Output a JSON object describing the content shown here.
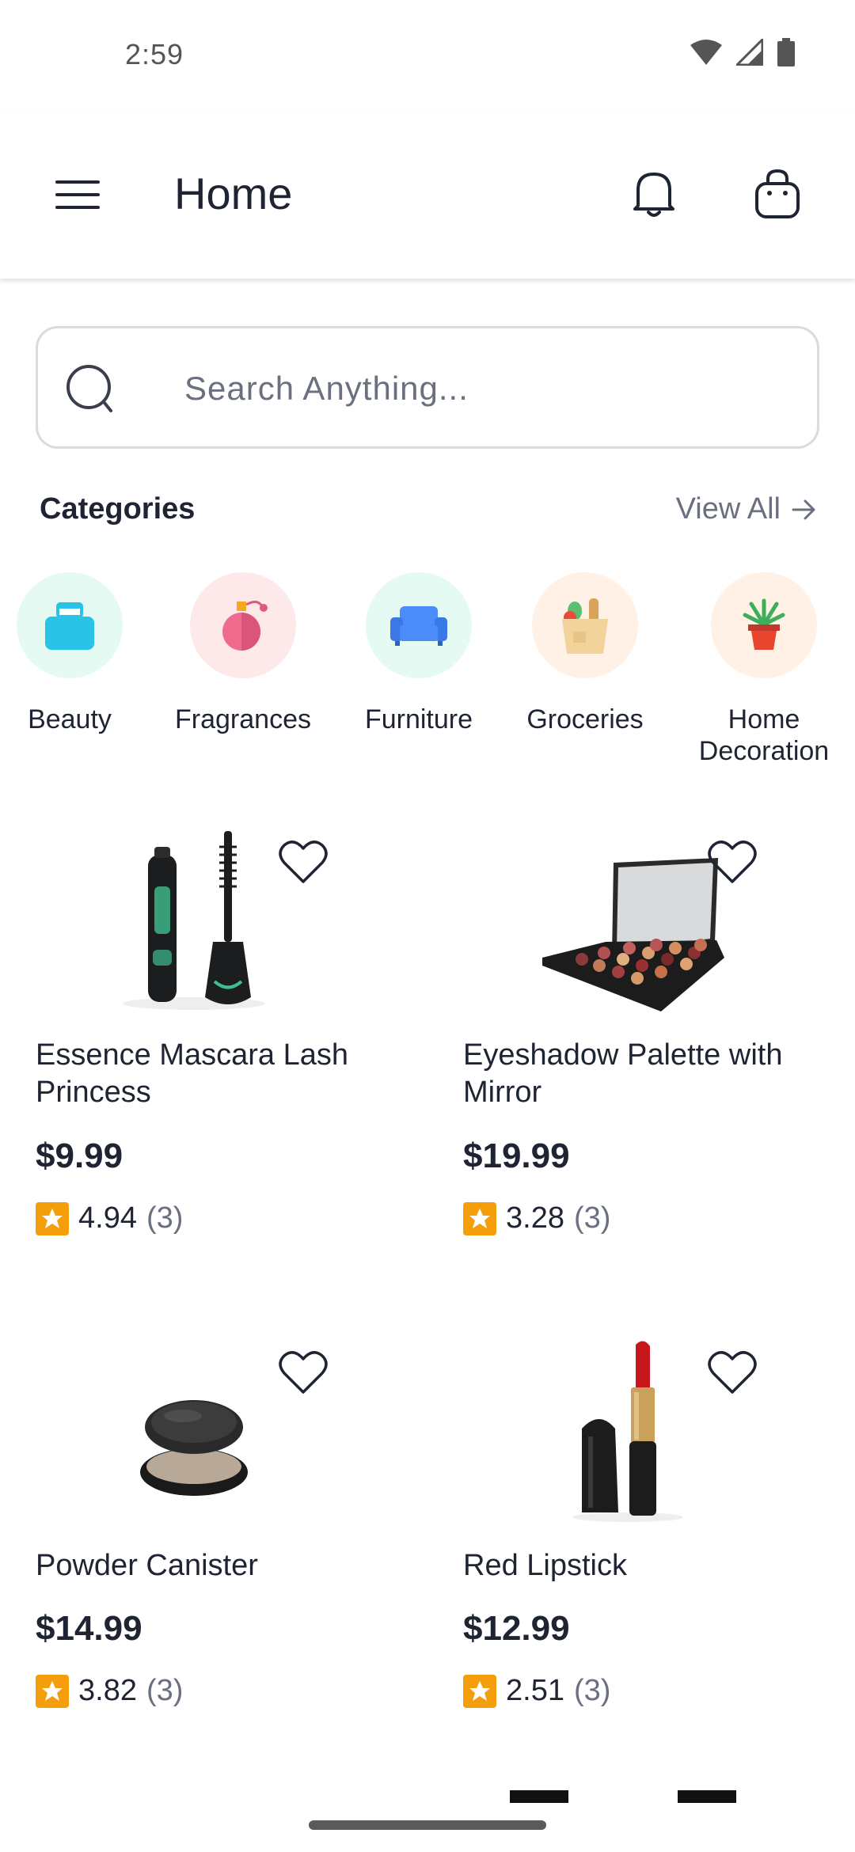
{
  "status": {
    "time": "2:59"
  },
  "header": {
    "title": "Home"
  },
  "search": {
    "placeholder": "Search Anything..."
  },
  "categories": {
    "title": "Categories",
    "view_all": "View All",
    "items": [
      {
        "label": "Beauty",
        "icon": "beauty-icon",
        "bg": "#e6faf4"
      },
      {
        "label": "Fragrances",
        "icon": "perfume-icon",
        "bg": "#fde8ea"
      },
      {
        "label": "Furniture",
        "icon": "sofa-icon",
        "bg": "#e6faf4"
      },
      {
        "label": "Groceries",
        "icon": "grocery-bag-icon",
        "bg": "#fff1e6"
      },
      {
        "label": "Home Decoration",
        "icon": "plant-pot-icon",
        "bg": "#fff1e6"
      }
    ]
  },
  "products": [
    {
      "name": "Essence Mascara Lash Princess",
      "price": "$9.99",
      "rating": "4.94",
      "reviews": "(3)",
      "icon": "mascara-image"
    },
    {
      "name": "Eyeshadow Palette with Mirror",
      "price": "$19.99",
      "rating": "3.28",
      "reviews": "(3)",
      "icon": "eyeshadow-palette-image"
    },
    {
      "name": "Powder Canister",
      "price": "$14.99",
      "rating": "3.82",
      "reviews": "(3)",
      "icon": "powder-canister-image"
    },
    {
      "name": "Red Lipstick",
      "price": "$12.99",
      "rating": "2.51",
      "reviews": "(3)",
      "icon": "lipstick-image"
    }
  ],
  "colors": {
    "star": "#f59e0b",
    "text": "#1f2433",
    "muted": "#6b7080"
  }
}
